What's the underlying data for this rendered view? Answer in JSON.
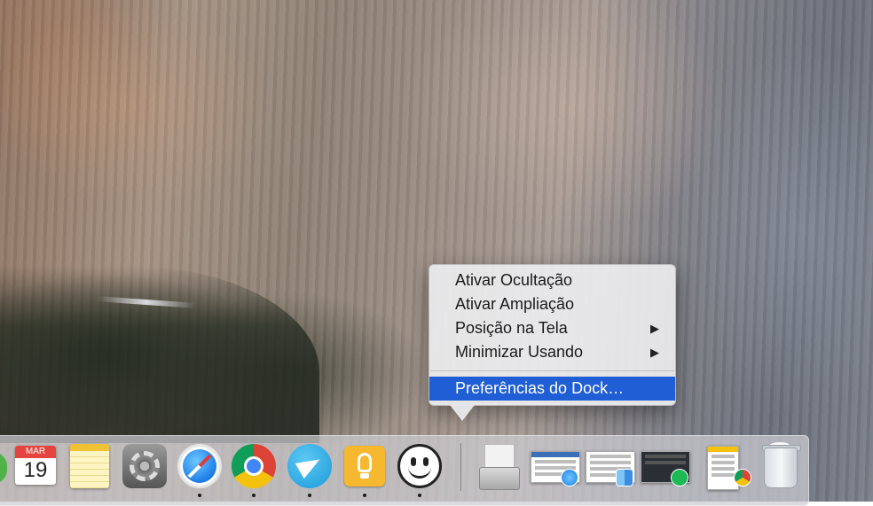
{
  "menu": {
    "items": [
      {
        "label": "Ativar Ocultação",
        "submenu": false
      },
      {
        "label": "Ativar Ampliação",
        "submenu": false
      },
      {
        "label": "Posição na Tela",
        "submenu": true
      },
      {
        "label": "Minimizar Usando",
        "submenu": true
      }
    ],
    "arrow_glyph": "▶",
    "preferences_label": "Preferências do Dock…",
    "highlight_color": "#1f5ed4"
  },
  "dock": {
    "calendar": {
      "month": "MAR",
      "day": "19"
    },
    "apps": [
      {
        "icon": "calendar-icon",
        "running": false
      },
      {
        "icon": "notes-icon",
        "running": false
      },
      {
        "icon": "system-preferences-icon",
        "running": false
      },
      {
        "icon": "safari-icon",
        "running": true
      },
      {
        "icon": "chrome-icon",
        "running": true
      },
      {
        "icon": "telegram-icon",
        "running": true
      },
      {
        "icon": "tips-icon",
        "running": true
      },
      {
        "icon": "smile-icon",
        "running": true
      }
    ],
    "minimized": [
      {
        "icon": "archive-utility-icon"
      },
      {
        "icon": "minimized-window-safari-icon",
        "badge": "safari-icon"
      },
      {
        "icon": "minimized-window-finder-icon",
        "badge": "finder-icon"
      },
      {
        "icon": "minimized-window-spotify-icon",
        "badge": "spotify-icon"
      },
      {
        "icon": "minimized-window-chrome-icon",
        "badge": "chrome-icon"
      },
      {
        "icon": "trash-icon"
      }
    ]
  }
}
